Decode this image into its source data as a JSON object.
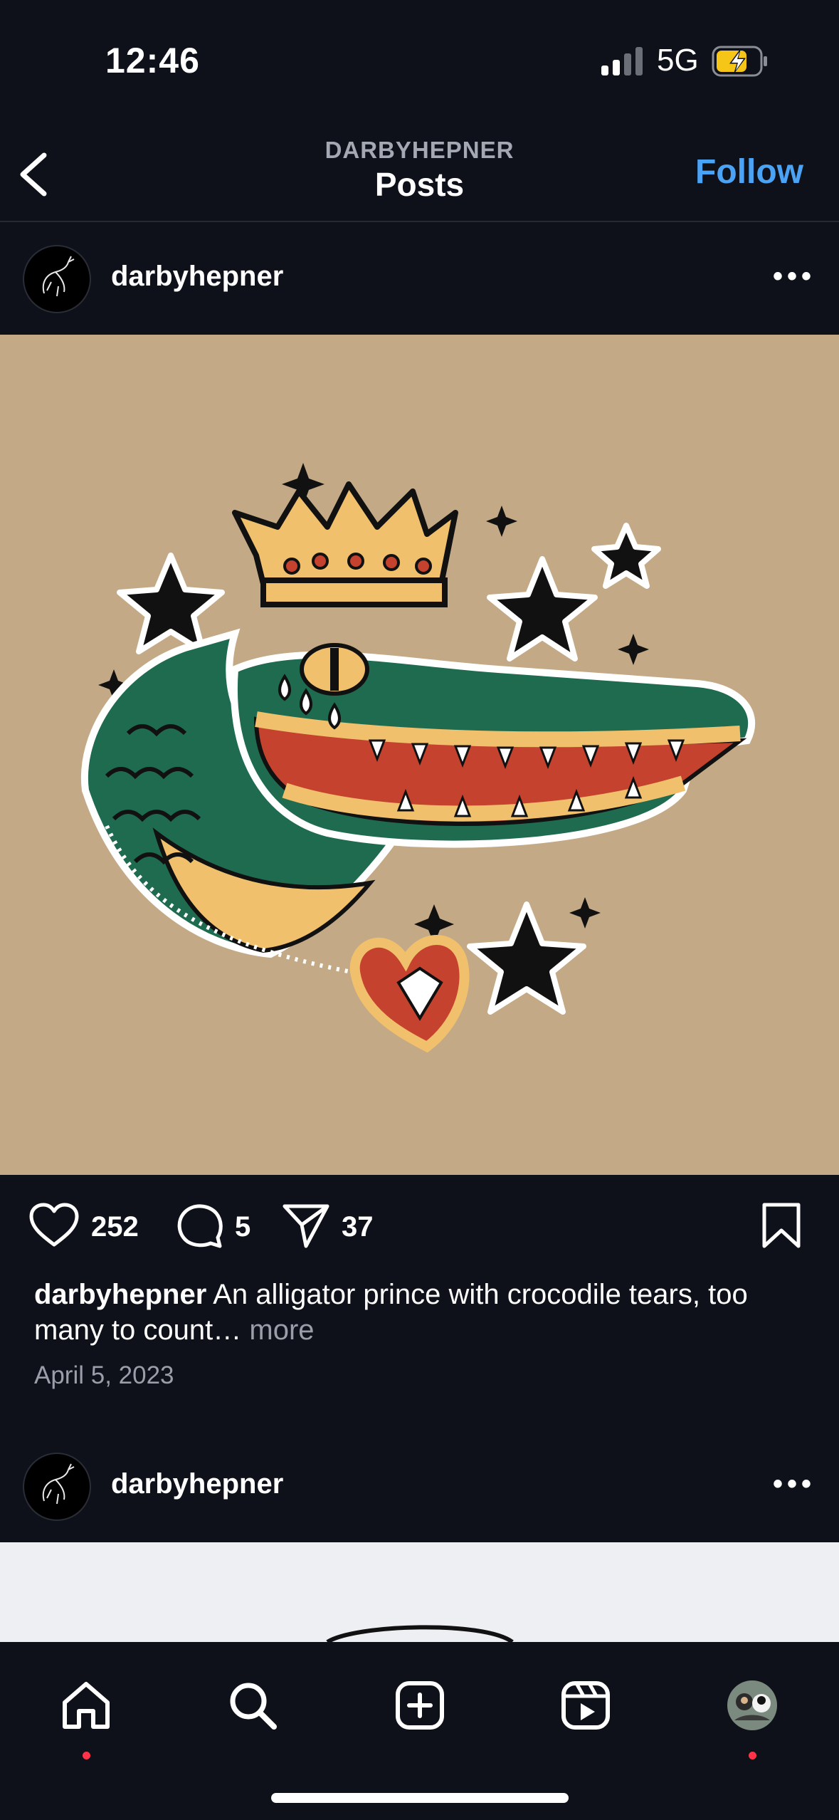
{
  "status_bar": {
    "time": "12:46",
    "network": "5G",
    "icons": [
      "signal-icon",
      "battery-charging-icon"
    ]
  },
  "header": {
    "username": "DARBYHEPNER",
    "title": "Posts",
    "follow_label": "Follow",
    "back_icon": "chevron-left-icon"
  },
  "post": {
    "username": "darbyhepner",
    "image_description_icon": "crowned-alligator-illustration",
    "likes": "252",
    "comments": "5",
    "shares": "37",
    "caption_user": "darbyhepner",
    "caption_text": " An alligator prince with crocodile tears, too many to count… ",
    "caption_more": "more",
    "date": "April 5, 2023"
  },
  "post2": {
    "username": "darbyhepner"
  },
  "tabbar": {
    "items": [
      {
        "name": "home",
        "icon": "home-icon",
        "notification": true
      },
      {
        "name": "search",
        "icon": "search-icon",
        "notification": false
      },
      {
        "name": "create",
        "icon": "plus-square-icon",
        "notification": false
      },
      {
        "name": "reels",
        "icon": "reels-icon",
        "notification": false
      },
      {
        "name": "profile",
        "icon": "avatar",
        "notification": true
      }
    ]
  },
  "colors": {
    "background": "#0e111a",
    "accent": "#4aa3f5",
    "image_bg": "#c3a985",
    "notification": "#ff3347"
  }
}
